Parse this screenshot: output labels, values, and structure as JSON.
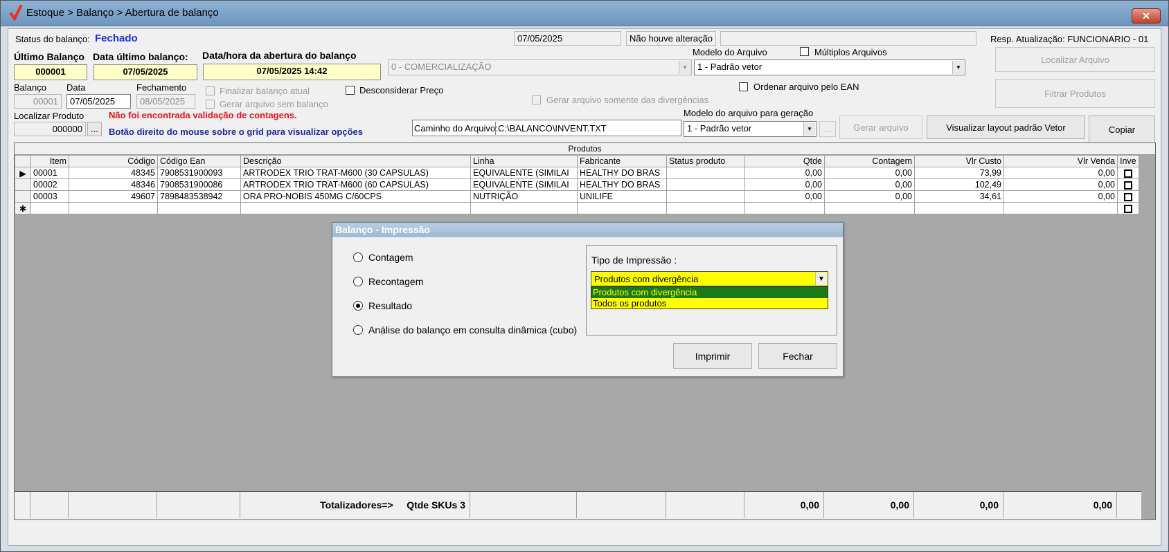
{
  "window": {
    "title": "Estoque > Balanço > Abertura de balanço",
    "close_label": "✕"
  },
  "header": {
    "status_label": "Status do balanço:",
    "status_value": "Fechado",
    "date_field": "07/05/2025",
    "change_label": "Não houve alteração",
    "change_value": "",
    "resp_label": "Resp. Atualização: FUNCIONARIO - 01"
  },
  "balance": {
    "ultimo_label": "Último Balanço",
    "ultimo_value": "000001",
    "data_ultimo_label": "Data último balanço:",
    "data_ultimo_value": "07/05/2025",
    "abertura_label": "Data/hora da abertura do balanço",
    "abertura_value": "07/05/2025 14:42",
    "tipo_value": "0 - COMERCIALIZAÇÃO",
    "modelo_label": "Modelo do Arquivo",
    "modelo_value": "1 - Padrão vetor",
    "multiplos_label": "Múltiplos Arquivos",
    "localizar_arquivo_label": "Localizar Arquivo",
    "balanco_label": "Balanço",
    "balanco_value": "00001",
    "data_label": "Data",
    "data_value": "07/05/2025",
    "fechamento_label": "Fechamento",
    "fechamento_value": "08/05/2025",
    "finalizar_label": "Finalizar balanço atual",
    "gerar_sem_label": "Gerar arquivo sem balanço",
    "desconsiderar_label": "Desconsiderar Preço",
    "gerar_div_label": "Gerar arquivo somente das divergências",
    "ordenar_label": "Ordenar arquivo pelo EAN",
    "filtrar_label": "Filtrar Produtos",
    "localizar_produto_label": "Localizar Produto",
    "localizar_produto_value": "000000",
    "ellipsis": "...",
    "aviso_vermelho": "Não foi encontrada validação de contagens.",
    "aviso_azul": "Botão direito do mouse sobre o grid para visualizar opções",
    "caminho_label": "Caminho do Arquivo:",
    "caminho_value": "C:\\BALANCO\\INVENT.TXT",
    "modelo_geracao_label": "Modelo do arquivo para geração",
    "modelo_geracao_value": "1 - Padrão vetor",
    "gerar_arquivo_label": "Gerar arquivo",
    "visualizar_label": "Visualizar layout padrão Vetor",
    "copiar_label": "Copiar"
  },
  "grid": {
    "caption": "Produtos",
    "columns": [
      "Item",
      "Código",
      "Código Ean",
      "Descrição",
      "Linha",
      "Fabricante",
      "Status produto",
      "Qtde",
      "Contagem",
      "Vlr Custo",
      "Vlr Venda",
      "Inve"
    ],
    "rows": [
      [
        "00001",
        "48345",
        "7908531900093",
        "ARTRODEX TRIO TRAT-M600 (30 CAPSULAS)",
        "EQUIVALENTE (SIMILAI",
        "HEALTHY DO BRAS",
        "",
        "0,00",
        "0,00",
        "73,99",
        "0,00"
      ],
      [
        "00002",
        "48346",
        "7908531900086",
        "ARTRODEX TRIO TRAT-M600 (60 CAPSULAS)",
        "EQUIVALENTE (SIMILAI",
        "HEALTHY DO BRAS",
        "",
        "0,00",
        "0,00",
        "102,49",
        "0,00"
      ],
      [
        "00003",
        "49607",
        "7898483538942",
        "ORA PRO-NOBIS 450MG C/60CPS",
        "NUTRIÇÃO",
        "UNILIFE",
        "",
        "0,00",
        "0,00",
        "34,61",
        "0,00"
      ]
    ],
    "current_marker": "▶",
    "new_marker": "✱",
    "totals_label": "Totalizadores=>",
    "skus_label": "Qtde SKUs 3",
    "total_qtde": "0,00",
    "total_contagem": "0,00",
    "total_custo": "0,00",
    "total_venda": "0,00"
  },
  "dialog": {
    "title": "Balanço - Impressão",
    "options": [
      "Contagem",
      "Recontagem",
      "Resultado",
      "Análise do balanço em consulta dinâmica (cubo)"
    ],
    "selected_option": "Resultado",
    "tipo_label": "Tipo de Impressão :",
    "tipo_value": "Produtos com divergência",
    "tipo_options": [
      "Produtos com divergência",
      "Todos os produtos"
    ],
    "imprimir_label": "Imprimir",
    "fechar_label": "Fechar"
  },
  "colors": {
    "dialog_combo_bg": "#ffff00",
    "selected_option_bg": "#1b7a17",
    "status_blue": "#1d2ee0",
    "warning_red": "#e8121a"
  }
}
